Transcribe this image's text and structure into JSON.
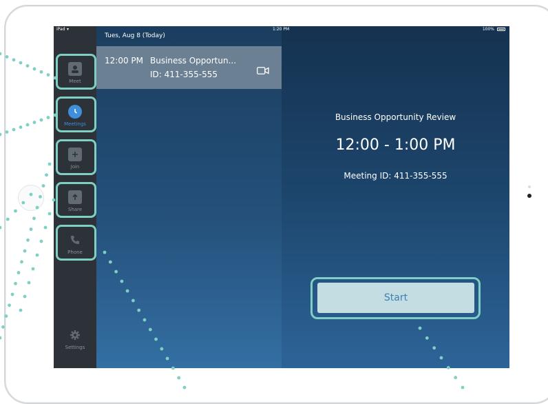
{
  "status_bar": {
    "carrier": "iPad",
    "time": "1:20 PM",
    "battery": "100%"
  },
  "sidebar": {
    "items": [
      {
        "label": "Meet",
        "icon": "video-person-icon"
      },
      {
        "label": "Meetings",
        "icon": "clock-icon"
      },
      {
        "label": "Join",
        "icon": "plus-icon"
      },
      {
        "label": "Share",
        "icon": "upload-arrow-icon"
      },
      {
        "label": "Phone",
        "icon": "phone-icon"
      }
    ],
    "settings": {
      "label": "Settings",
      "icon": "gear-icon"
    }
  },
  "meeting_list": {
    "date_header": "Tues, Aug 8 (Today)",
    "meetings": [
      {
        "time": "12:00 PM",
        "title": "Business Opportun...",
        "meeting_id": "ID: 411-355-555",
        "icon": "video-camera-icon"
      }
    ]
  },
  "detail": {
    "title": "Business Opportunity Review",
    "time_range": "12:00 - 1:00 PM",
    "meeting_id": "Meeting ID: 411-355-555",
    "start_label": "Start"
  },
  "colors": {
    "highlight": "#7fcfc4",
    "active_blue": "#3f8fda",
    "sidebar_bg": "#2c3238",
    "selected_row": "#6b8193",
    "start_button_bg": "#c4dde2"
  }
}
